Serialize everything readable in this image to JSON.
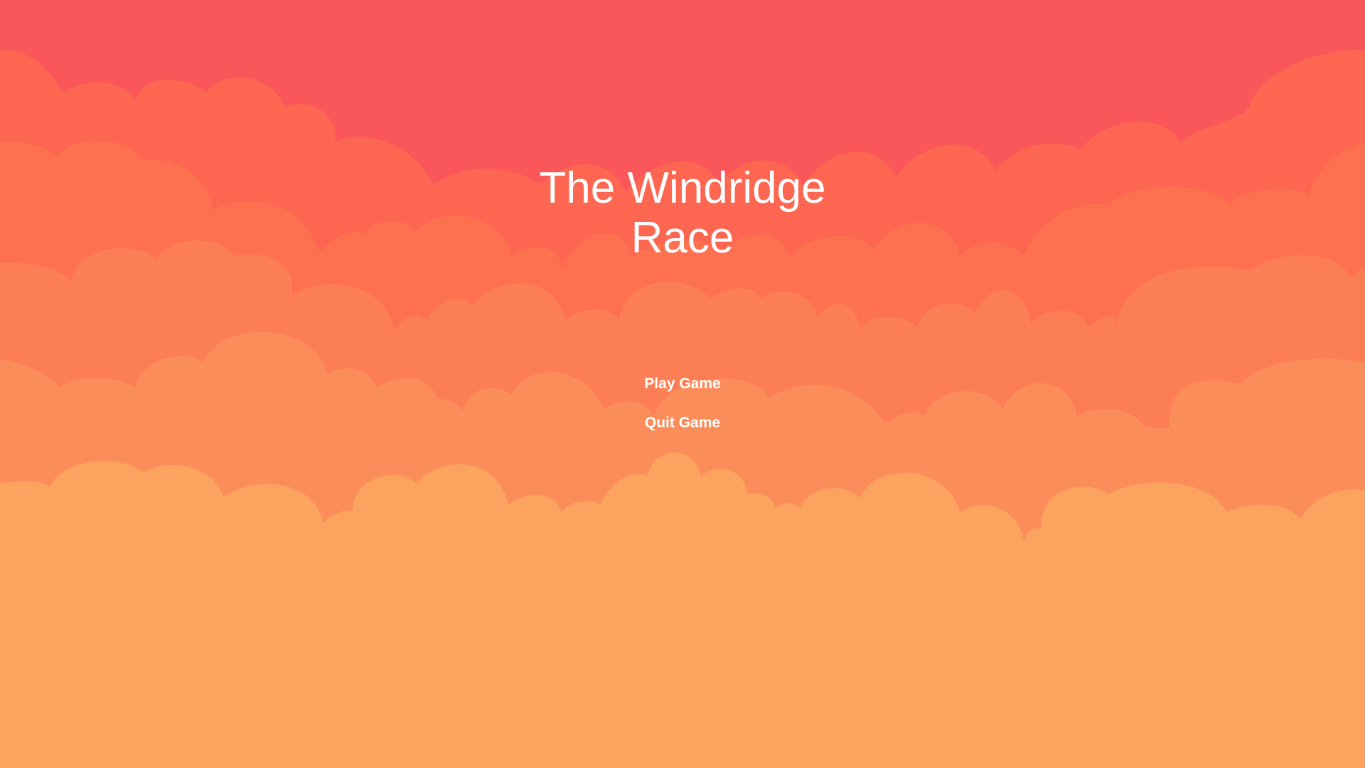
{
  "title": {
    "line1": "The Windridge",
    "line2": "Race"
  },
  "menu": {
    "play_label": "Play Game",
    "quit_label": "Quit Game"
  },
  "colors": {
    "sky_top": "#fa575a",
    "cloud_layers": [
      "#fc5d54",
      "#fd6650",
      "#fd7151",
      "#fc7e55",
      "#fb8d5a",
      "#fba35f"
    ],
    "text": "#ffffff"
  }
}
